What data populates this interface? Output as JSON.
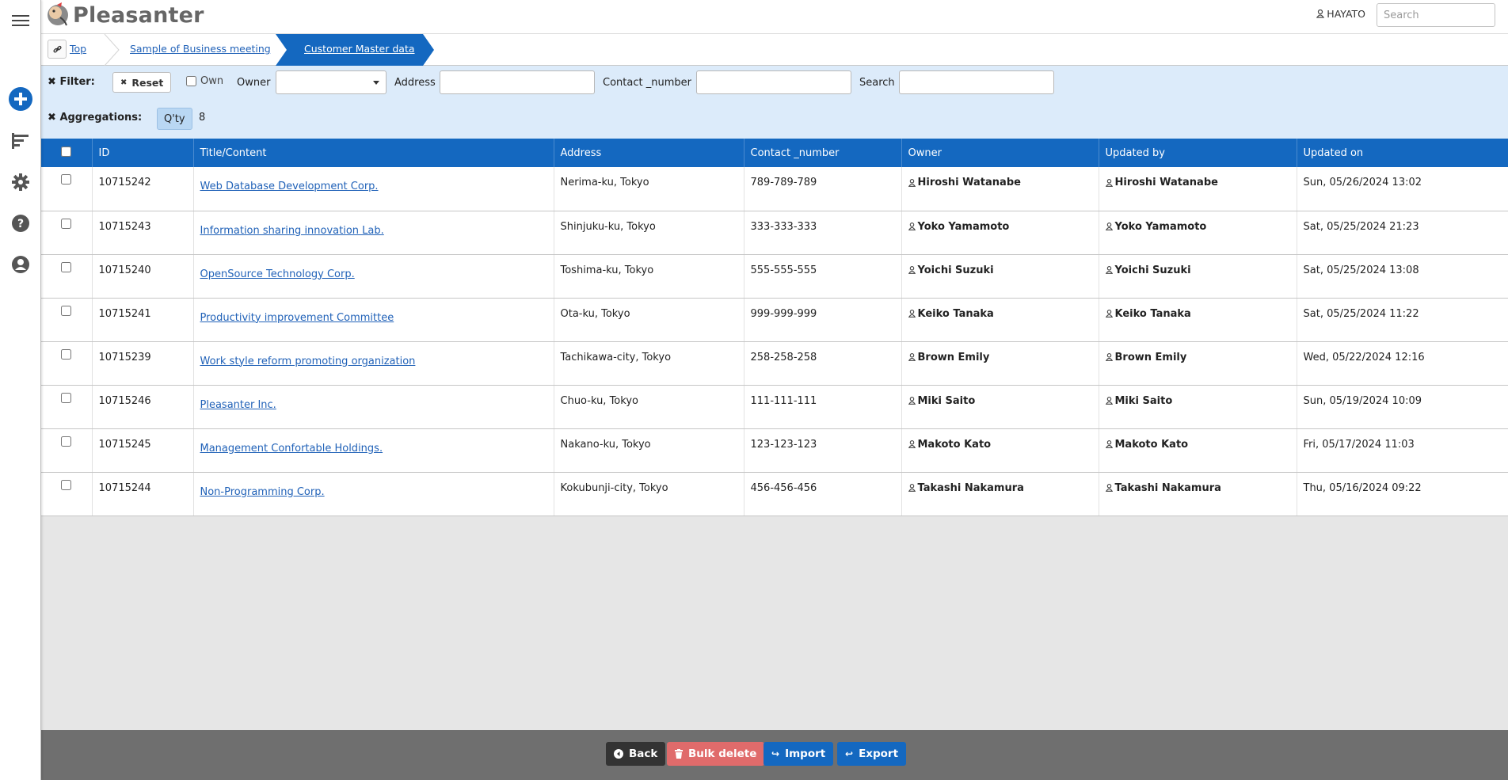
{
  "app": {
    "name": "Pleasanter"
  },
  "header": {
    "user_name": "HAYATO",
    "search_placeholder": "Search"
  },
  "rail": {
    "icons": [
      "menu-icon",
      "add-icon",
      "sort-icon",
      "gear-icon",
      "help-icon",
      "account-icon"
    ]
  },
  "breadcrumb": {
    "items": [
      "Top",
      "Sample of Business meeting",
      "Customer Master data"
    ]
  },
  "filters": {
    "filter_label": "Filter:",
    "reset_label": "Reset",
    "own_label": "Own",
    "owner_label": "Owner",
    "owner_value": "",
    "address_label": "Address",
    "address_value": "",
    "contact_label": "Contact _number",
    "contact_value": "",
    "search_label": "Search",
    "search_value": "",
    "aggregations_label": "Aggregations:",
    "qty_label": "Q'ty",
    "qty_value": "8"
  },
  "table": {
    "columns": [
      "ID",
      "Title/Content",
      "Address",
      "Contact _number",
      "Owner",
      "Updated by",
      "Updated on"
    ],
    "rows": [
      {
        "id": "10715242",
        "title": "Web Database Development Corp.",
        "address": "Nerima-ku, Tokyo",
        "contact": "789-789-789",
        "owner": "Hiroshi Watanabe",
        "updated_by": "Hiroshi Watanabe",
        "updated_on": "Sun, 05/26/2024 13:02"
      },
      {
        "id": "10715243",
        "title": "Information sharing innovation Lab.",
        "address": "Shinjuku-ku, Tokyo",
        "contact": "333-333-333",
        "owner": "Yoko Yamamoto",
        "updated_by": "Yoko Yamamoto",
        "updated_on": "Sat, 05/25/2024 21:23"
      },
      {
        "id": "10715240",
        "title": "OpenSource Technology Corp.",
        "address": "Toshima-ku, Tokyo",
        "contact": "555-555-555",
        "owner": "Yoichi Suzuki",
        "updated_by": "Yoichi Suzuki",
        "updated_on": "Sat, 05/25/2024 13:08"
      },
      {
        "id": "10715241",
        "title": "Productivity improvement Committee",
        "address": "Ota-ku, Tokyo",
        "contact": "999-999-999",
        "owner": "Keiko Tanaka",
        "updated_by": "Keiko Tanaka",
        "updated_on": "Sat, 05/25/2024 11:22"
      },
      {
        "id": "10715239",
        "title": "Work style reform promoting organization",
        "address": "Tachikawa-city, Tokyo",
        "contact": "258-258-258",
        "owner": "Brown Emily",
        "updated_by": "Brown Emily",
        "updated_on": "Wed, 05/22/2024 12:16"
      },
      {
        "id": "10715246",
        "title": "Pleasanter Inc.",
        "address": "Chuo-ku, Tokyo",
        "contact": "111-111-111",
        "owner": "Miki Saito",
        "updated_by": "Miki Saito",
        "updated_on": "Sun, 05/19/2024 10:09"
      },
      {
        "id": "10715245",
        "title": "Management Confortable Holdings.",
        "address": "Nakano-ku, Tokyo",
        "contact": "123-123-123",
        "owner": "Makoto Kato",
        "updated_by": "Makoto Kato",
        "updated_on": "Fri, 05/17/2024 11:03"
      },
      {
        "id": "10715244",
        "title": "Non-Programming Corp.",
        "address": "Kokubunji-city, Tokyo",
        "contact": "456-456-456",
        "owner": "Takashi Nakamura",
        "updated_by": "Takashi Nakamura",
        "updated_on": "Thu, 05/16/2024 09:22"
      }
    ]
  },
  "footer": {
    "back_label": "Back",
    "bulk_delete_label": "Bulk delete",
    "import_label": "Import",
    "export_label": "Export"
  },
  "colors": {
    "accent": "#1468c0",
    "filter_bg": "#dcebfa",
    "danger": "#e06b6b",
    "footer_bg": "#6f6f6f"
  }
}
